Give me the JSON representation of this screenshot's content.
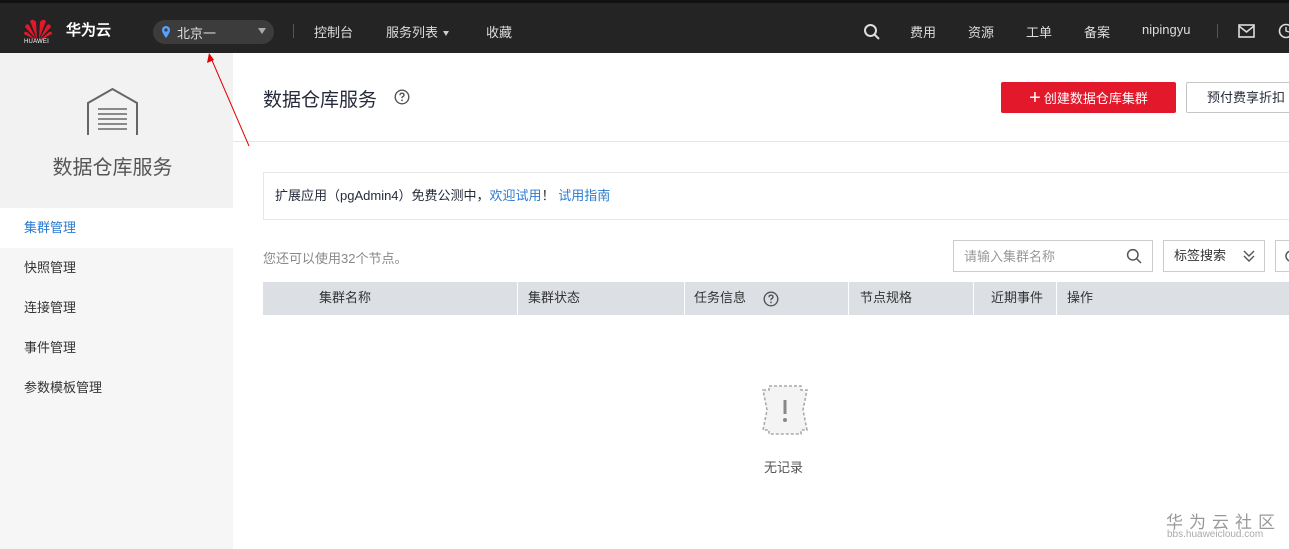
{
  "topbar": {
    "logo_text": "HUAWEI",
    "brand": "华为云",
    "region": "北京一",
    "nav": [
      "控制台",
      "服务列表",
      "收藏"
    ],
    "right_nav": [
      "费用",
      "资源",
      "工单",
      "备案"
    ],
    "username": "nipingyu"
  },
  "sidebar": {
    "title": "数据仓库服务",
    "items": [
      {
        "label": "集群管理",
        "active": true
      },
      {
        "label": "快照管理",
        "active": false
      },
      {
        "label": "连接管理",
        "active": false
      },
      {
        "label": "事件管理",
        "active": false
      },
      {
        "label": "参数模板管理",
        "active": false
      }
    ]
  },
  "main": {
    "title": "数据仓库服务",
    "create_button": "创建数据仓库集群",
    "prepaid_button": "预付费享折扣",
    "notice": {
      "text": "扩展应用（pgAdmin4）免费公测中，",
      "link1": "欢迎试用",
      "sep": "！",
      "link2": "试用指南"
    },
    "quota_text": "您还可以使用32个节点。",
    "search_placeholder": "请输入集群名称",
    "tag_search": "标签搜索",
    "columns": [
      "集群名称",
      "集群状态",
      "任务信息",
      "节点规格",
      "近期事件",
      "操作"
    ],
    "empty_text": "无记录"
  },
  "watermark": {
    "title": "华为云社区",
    "url": "bbs.huaweicloud.com"
  },
  "colors": {
    "topbar_bg": "#242424",
    "primary_red": "#e3182a",
    "link_blue": "#2a7ad0",
    "table_header_bg": "#dcdfe4",
    "annotation_red": "#e00000"
  }
}
